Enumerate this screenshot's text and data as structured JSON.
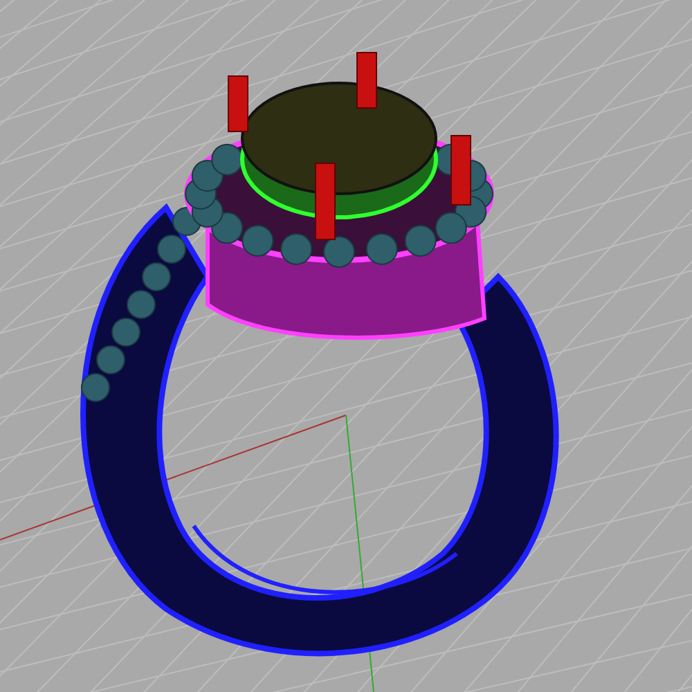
{
  "viewport": {
    "grid": {
      "visible": true
    },
    "axes": {
      "visible": true
    },
    "model": {
      "kind": "ring"
    }
  }
}
